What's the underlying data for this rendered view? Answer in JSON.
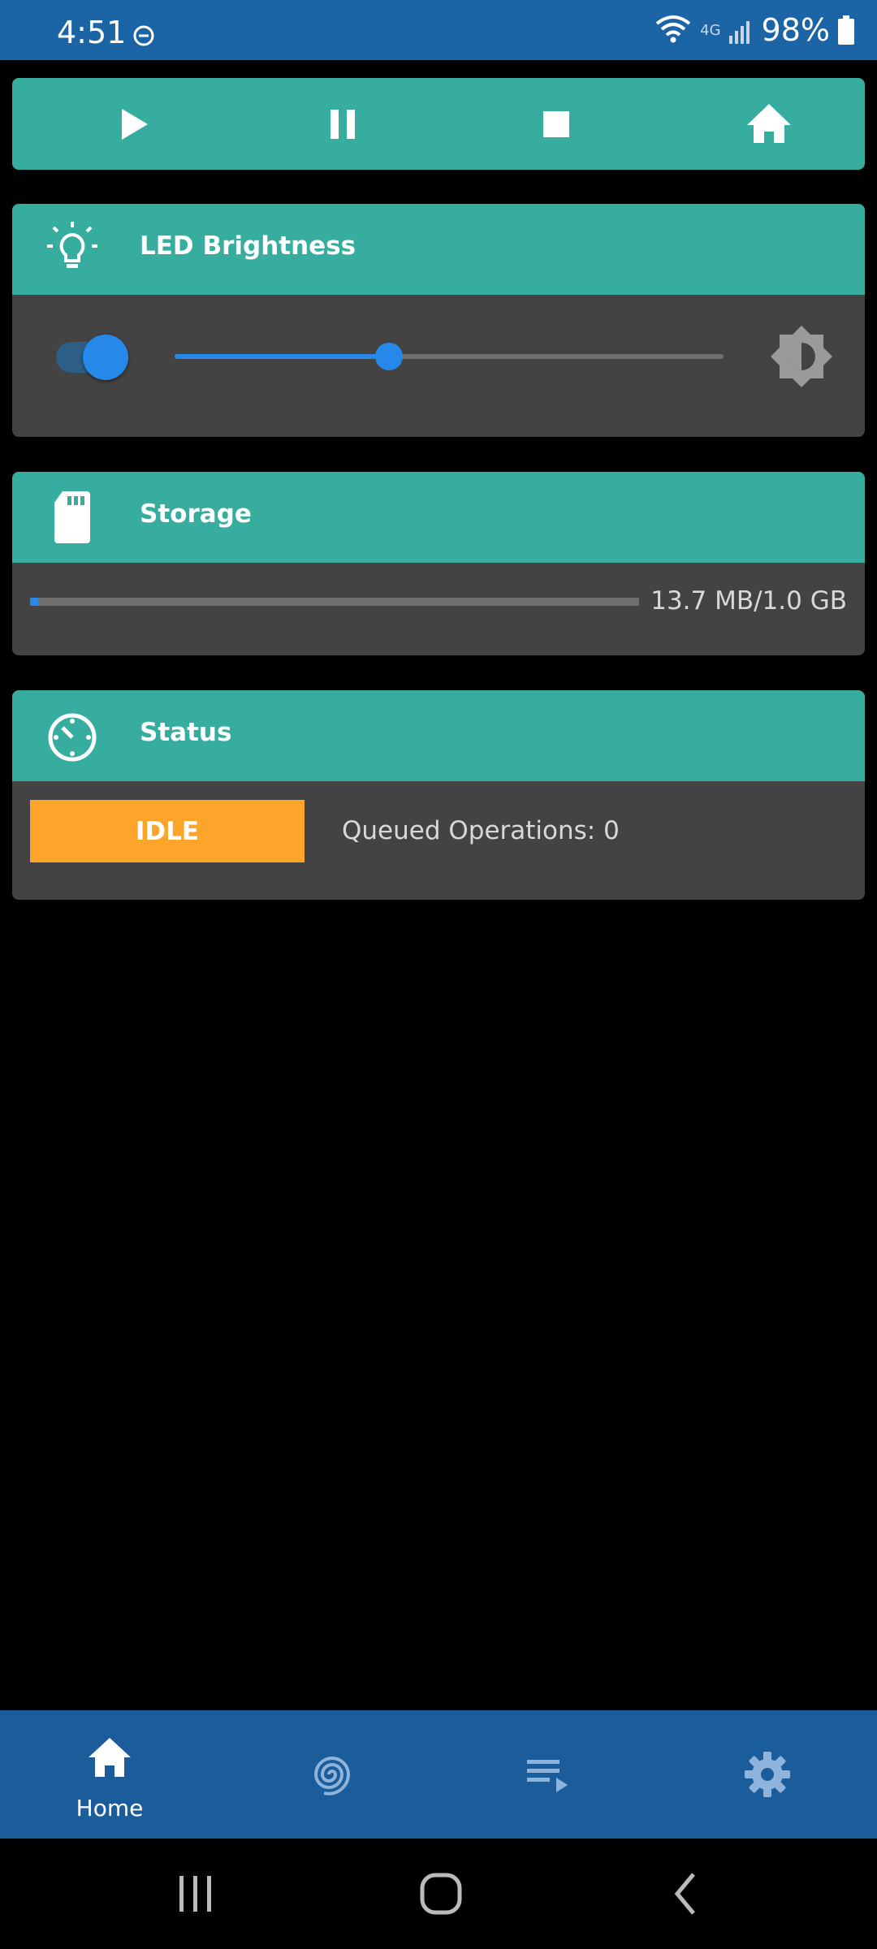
{
  "status_bar": {
    "time": "4:51",
    "network": "4G",
    "battery": "98%"
  },
  "controls": {
    "play_icon": "play-icon",
    "pause_icon": "pause-icon",
    "stop_icon": "stop-icon",
    "home_icon": "home-icon"
  },
  "led": {
    "title": "LED Brightness",
    "enabled": true,
    "brightness_fraction": 0.39
  },
  "storage": {
    "title": "Storage",
    "usage": "13.7 MB/1.0 GB",
    "used_fraction": 0.0134
  },
  "status": {
    "title": "Status",
    "state": "IDLE",
    "queued": "Queued Operations: 0"
  },
  "nav": {
    "items": [
      {
        "label": "Home",
        "icon": "home-icon",
        "active": true
      },
      {
        "label": "",
        "icon": "spiral-icon",
        "active": false
      },
      {
        "label": "",
        "icon": "playlist-icon",
        "active": false
      },
      {
        "label": "",
        "icon": "gear-icon",
        "active": false
      }
    ]
  },
  "colors": {
    "header_teal": "#37ad9f",
    "card_bg": "#444343",
    "accent_blue": "#2689ea",
    "idle_orange": "#fca52a",
    "nav_blue": "#1b5d9b"
  }
}
